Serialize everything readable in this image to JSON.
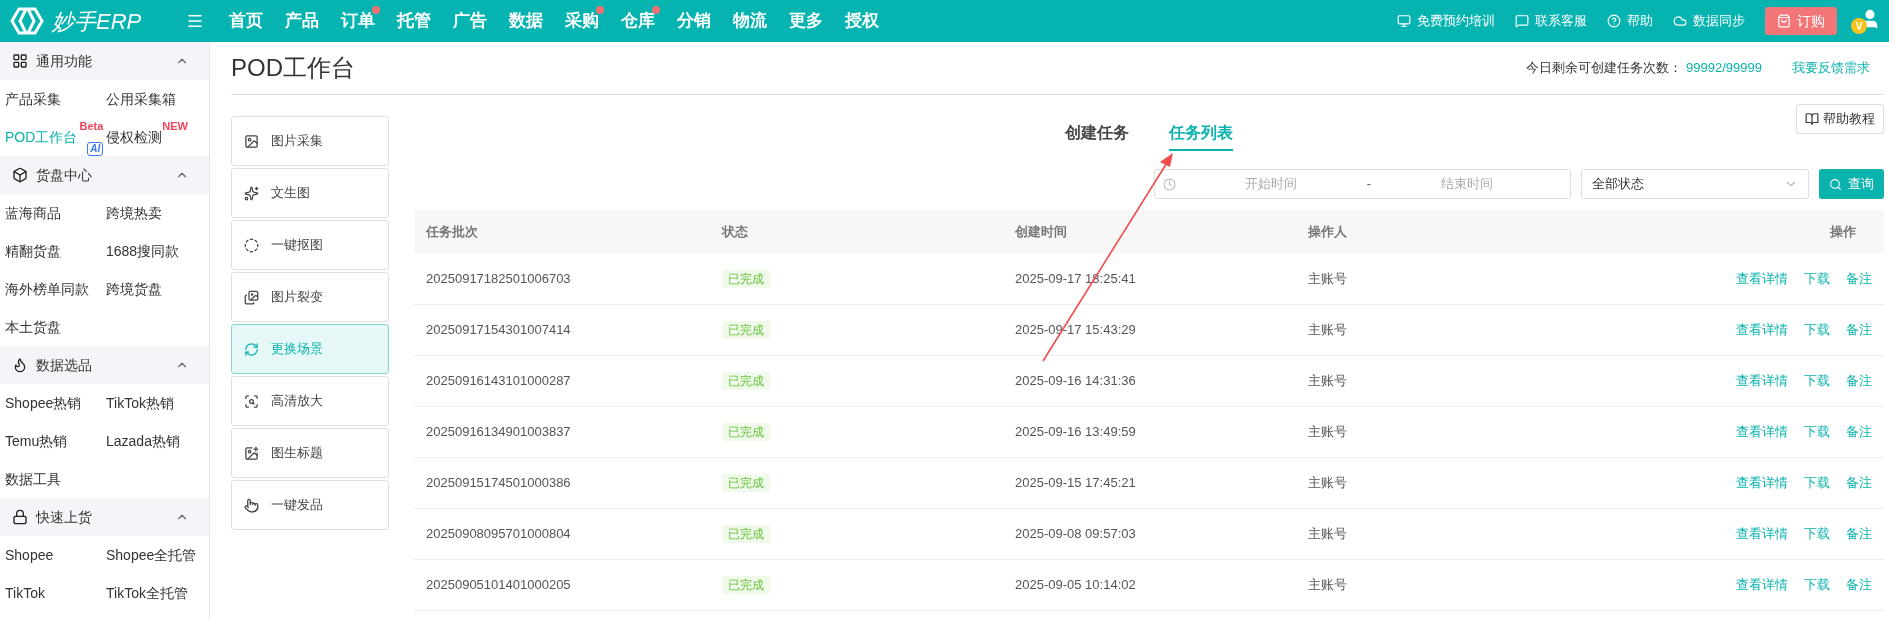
{
  "brand": {
    "name": "妙手ERP"
  },
  "nav": [
    {
      "label": "首页",
      "badge": false
    },
    {
      "label": "产品",
      "badge": false
    },
    {
      "label": "订单",
      "badge": true
    },
    {
      "label": "托管",
      "badge": false
    },
    {
      "label": "广告",
      "badge": false
    },
    {
      "label": "数据",
      "badge": false
    },
    {
      "label": "采购",
      "badge": true
    },
    {
      "label": "仓库",
      "badge": true
    },
    {
      "label": "分销",
      "badge": false
    },
    {
      "label": "物流",
      "badge": false
    },
    {
      "label": "更多",
      "badge": false
    },
    {
      "label": "授权",
      "badge": false
    }
  ],
  "header_links": [
    {
      "label": "免费预约培训",
      "kind": "training"
    },
    {
      "label": "联系客服",
      "kind": "chat"
    },
    {
      "label": "帮助",
      "kind": "help"
    },
    {
      "label": "数据同步",
      "kind": "sync"
    }
  ],
  "order_button": "订购",
  "avatar_badge": "V",
  "sidebar": [
    {
      "title": "通用功能",
      "kind": "grid",
      "expanded": true,
      "items": [
        {
          "label": "产品采集",
          "selected": false
        },
        {
          "label": "公用采集箱",
          "selected": false
        },
        {
          "label": "POD工作台",
          "selected": true,
          "tag": "Beta",
          "sub_tag": "AI"
        },
        {
          "label": "侵权检测",
          "selected": false,
          "tag": "NEW"
        }
      ]
    },
    {
      "title": "货盘中心",
      "kind": "box",
      "expanded": true,
      "items": [
        {
          "label": "蓝海商品",
          "selected": false
        },
        {
          "label": "跨境热卖",
          "selected": false
        },
        {
          "label": "精翻货盘",
          "selected": false
        },
        {
          "label": "1688搜同款",
          "selected": false
        },
        {
          "label": "海外榜单同款",
          "selected": false
        },
        {
          "label": "跨境货盘",
          "selected": false
        },
        {
          "label": "本土货盘",
          "selected": false
        }
      ]
    },
    {
      "title": "数据选品",
      "kind": "fire",
      "expanded": true,
      "items": [
        {
          "label": "Shopee热销",
          "selected": false
        },
        {
          "label": "TikTok热销",
          "selected": false
        },
        {
          "label": "Temu热销",
          "selected": false
        },
        {
          "label": "Lazada热销",
          "selected": false
        },
        {
          "label": "数据工具",
          "selected": false
        }
      ]
    },
    {
      "title": "快速上货",
      "kind": "bag",
      "expanded": true,
      "items": [
        {
          "label": "Shopee",
          "selected": false
        },
        {
          "label": "Shopee全托管",
          "selected": false
        },
        {
          "label": "TikTok",
          "selected": false
        },
        {
          "label": "TikTok全托管",
          "selected": false
        }
      ]
    }
  ],
  "page_title": "POD工作台",
  "quota": {
    "label": "今日剩余可创建任务次数：",
    "value": "99992/99999"
  },
  "feedback_link": "我要反馈需求",
  "tools": [
    {
      "label": "图片采集",
      "kind": "image",
      "selected": false
    },
    {
      "label": "文生图",
      "kind": "text2img",
      "selected": false
    },
    {
      "label": "一键抠图",
      "kind": "cutout",
      "selected": false
    },
    {
      "label": "图片裂变",
      "kind": "variant",
      "selected": false
    },
    {
      "label": "更换场景",
      "kind": "scene",
      "selected": true
    },
    {
      "label": "高清放大",
      "kind": "upscale",
      "selected": false
    },
    {
      "label": "图生标题",
      "kind": "title",
      "selected": false
    },
    {
      "label": "一键发品",
      "kind": "publish",
      "selected": false
    }
  ],
  "tabs": [
    {
      "label": "创建任务",
      "selected": false
    },
    {
      "label": "任务列表",
      "selected": true
    }
  ],
  "help_button": "帮助教程",
  "filters": {
    "start_placeholder": "开始时间",
    "separator": "-",
    "end_placeholder": "结束时间",
    "status_value": "全部状态",
    "query_button": "查询"
  },
  "table": {
    "columns": [
      "任务批次",
      "状态",
      "创建时间",
      "操作人",
      "操作"
    ],
    "rows": [
      {
        "batch": "20250917182501006703",
        "status": "已完成",
        "created": "2025-09-17 18:25:41",
        "operator": "主账号",
        "actions": [
          "查看详情",
          "下载",
          "备注"
        ]
      },
      {
        "batch": "20250917154301007414",
        "status": "已完成",
        "created": "2025-09-17 15:43:29",
        "operator": "主账号",
        "actions": [
          "查看详情",
          "下载",
          "备注"
        ]
      },
      {
        "batch": "20250916143101000287",
        "status": "已完成",
        "created": "2025-09-16 14:31:36",
        "operator": "主账号",
        "actions": [
          "查看详情",
          "下载",
          "备注"
        ]
      },
      {
        "batch": "20250916134901003837",
        "status": "已完成",
        "created": "2025-09-16 13:49:59",
        "operator": "主账号",
        "actions": [
          "查看详情",
          "下载",
          "备注"
        ]
      },
      {
        "batch": "20250915174501000386",
        "status": "已完成",
        "created": "2025-09-15 17:45:21",
        "operator": "主账号",
        "actions": [
          "查看详情",
          "下载",
          "备注"
        ]
      },
      {
        "batch": "20250908095701000804",
        "status": "已完成",
        "created": "2025-09-08 09:57:03",
        "operator": "主账号",
        "actions": [
          "查看详情",
          "下载",
          "备注"
        ]
      },
      {
        "batch": "20250905101401000205",
        "status": "已完成",
        "created": "2025-09-05 10:14:02",
        "operator": "主账号",
        "actions": [
          "查看详情",
          "下载",
          "备注"
        ]
      }
    ]
  }
}
